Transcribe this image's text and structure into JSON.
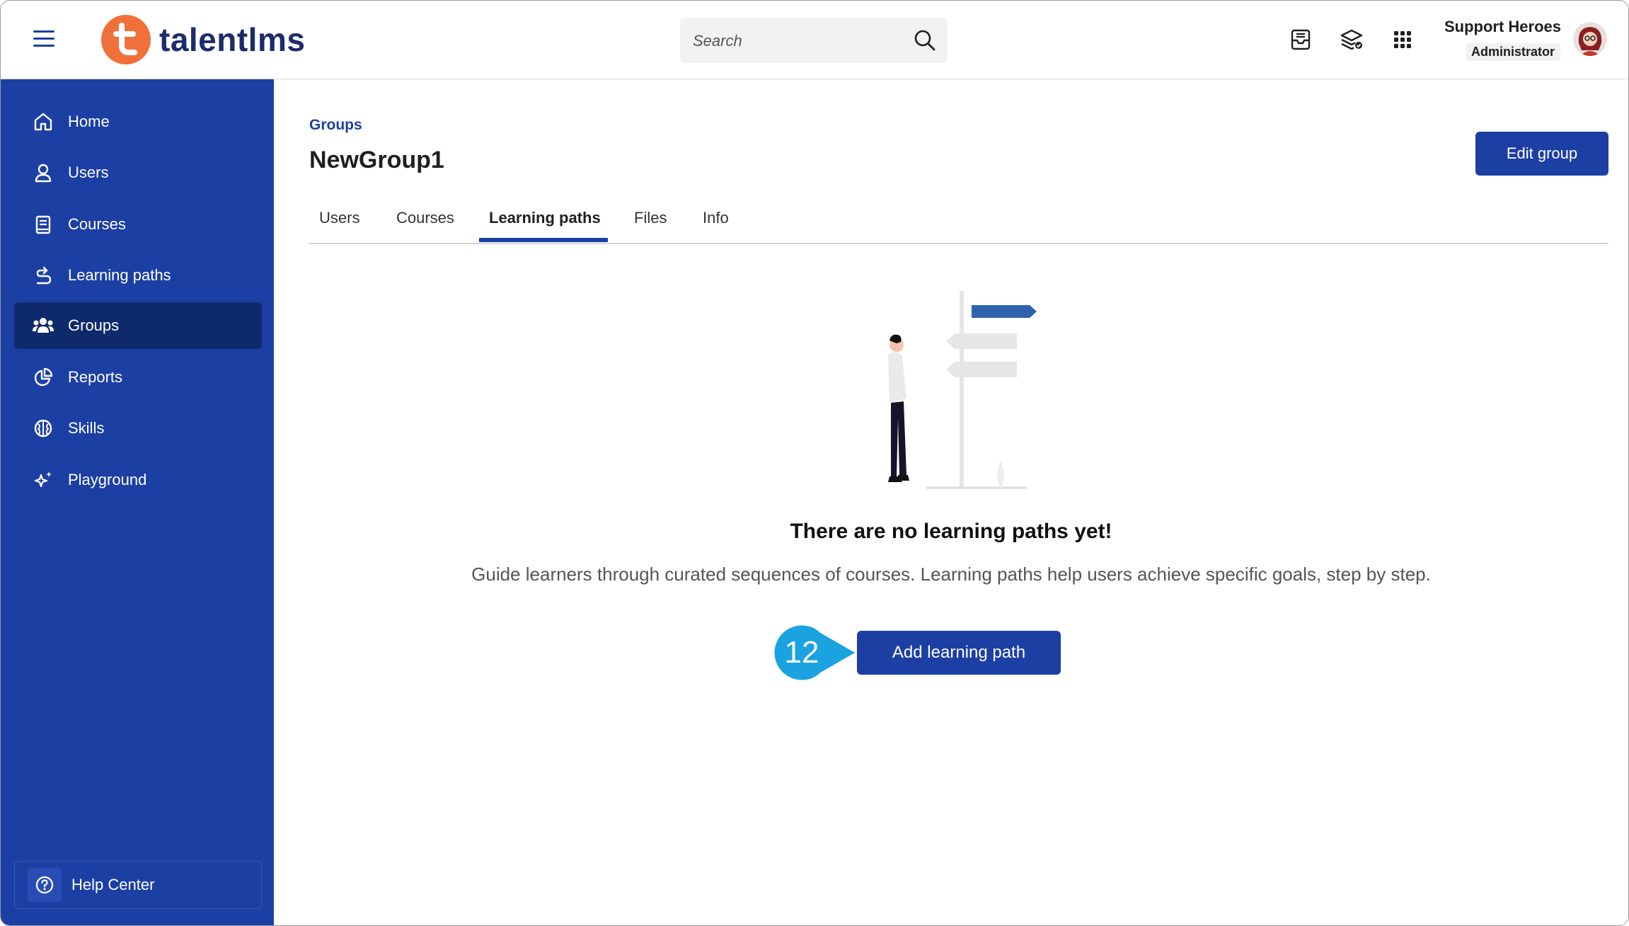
{
  "header": {
    "logo_text": "talentlms",
    "search_placeholder": "Search",
    "user_name": "Support Heroes",
    "user_role": "Administrator"
  },
  "sidebar": {
    "items": [
      {
        "label": "Home",
        "icon": "home-icon"
      },
      {
        "label": "Users",
        "icon": "user-icon"
      },
      {
        "label": "Courses",
        "icon": "book-icon"
      },
      {
        "label": "Learning paths",
        "icon": "path-icon"
      },
      {
        "label": "Groups",
        "icon": "groups-icon",
        "active": true
      },
      {
        "label": "Reports",
        "icon": "pie-chart-icon"
      },
      {
        "label": "Skills",
        "icon": "brain-icon"
      },
      {
        "label": "Playground",
        "icon": "sparkle-icon"
      }
    ],
    "help_label": "Help Center"
  },
  "main": {
    "breadcrumb": "Groups",
    "title": "NewGroup1",
    "edit_button": "Edit group",
    "tabs": [
      {
        "label": "Users"
      },
      {
        "label": "Courses"
      },
      {
        "label": "Learning paths",
        "active": true
      },
      {
        "label": "Files"
      },
      {
        "label": "Info"
      }
    ],
    "empty_title": "There are no learning paths yet!",
    "empty_desc": "Guide learners through curated sequences of courses. Learning paths help users achieve specific goals, step by step.",
    "add_button": "Add learning path",
    "callout_number": "12"
  },
  "colors": {
    "primary": "#1c3fa4",
    "sidebar_active": "#0f2a6b",
    "logo_orange": "#f0703a",
    "callout": "#1aa3e0"
  }
}
